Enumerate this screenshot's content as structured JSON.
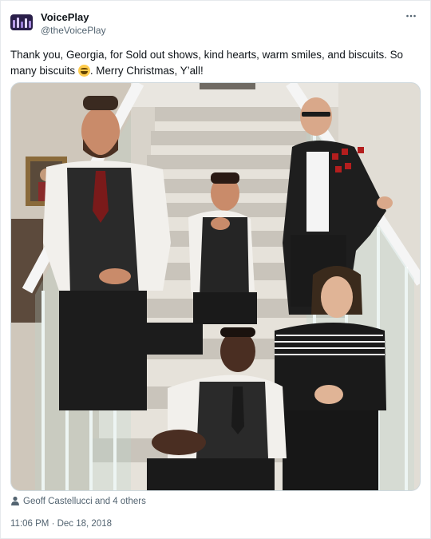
{
  "account": {
    "display_name": "VoicePlay",
    "handle": "@theVoicePlay",
    "avatar_icon": "voiceplay-logo",
    "more_icon": "more-options-icon"
  },
  "tweet": {
    "text_part1": "Thank you, Georgia, for Sold out shows, kind hearts, warm smiles, and biscuits. So many biscuits",
    "emoji": "grinning-face-emoji",
    "text_part2": ". Merry Christmas, Y’all!",
    "photo_alt": "group-photo-on-staircase"
  },
  "tagged": {
    "icon": "person-icon",
    "label": "Geoff Castellucci and 4 others"
  },
  "timestamp": "11:06 PM · Dec 18, 2018",
  "colors": {
    "text": "#0f1419",
    "secondary": "#536471",
    "border": "#cfd9de"
  }
}
